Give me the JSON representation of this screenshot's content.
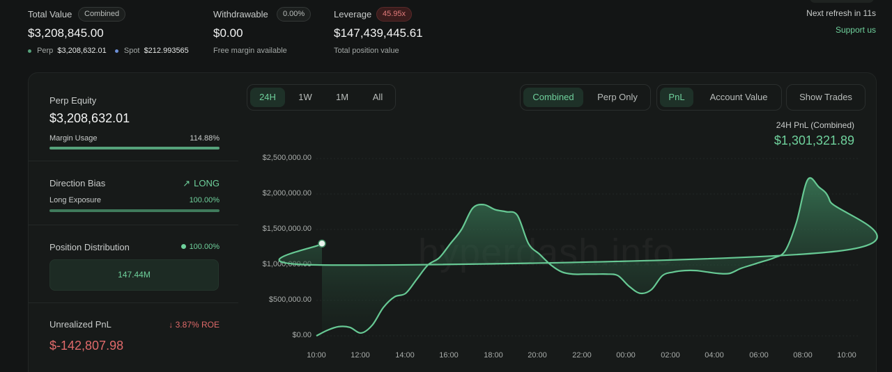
{
  "summary": {
    "total_value": {
      "label": "Total Value",
      "badge": "Combined",
      "value": "$3,208,845.00",
      "perp_label": "Perp",
      "perp_value": "$3,208,632.01",
      "spot_label": "Spot",
      "spot_value": "$212.993565"
    },
    "withdrawable": {
      "label": "Withdrawable",
      "badge": "0.00%",
      "value": "$0.00",
      "sub": "Free margin available"
    },
    "leverage": {
      "label": "Leverage",
      "badge": "45.95x",
      "value": "$147,439,445.61",
      "sub": "Total position value"
    },
    "refresh": "Next refresh in 11s",
    "support": "Support us"
  },
  "sidebar": {
    "perp_equity": {
      "label": "Perp Equity",
      "value": "$3,208,632.01",
      "margin_label": "Margin Usage",
      "margin_value": "114.88%"
    },
    "direction": {
      "label": "Direction Bias",
      "value": "LONG",
      "exposure_label": "Long Exposure",
      "exposure_value": "100.00%"
    },
    "distribution": {
      "label": "Position Distribution",
      "value": "100.00%",
      "box_value": "147.44M"
    },
    "unrealized": {
      "label": "Unrealized PnL",
      "roe": "↓ 3.87% ROE",
      "value": "$-142,807.98"
    }
  },
  "controls": {
    "ranges": [
      "24H",
      "1W",
      "1M",
      "All"
    ],
    "range_selected": "24H",
    "modes": [
      "Combined",
      "Perp Only"
    ],
    "mode_selected": "Combined",
    "metrics": [
      "PnL",
      "Account Value"
    ],
    "metric_selected": "PnL",
    "show_trades": "Show Trades"
  },
  "chart_info": {
    "title": "24H PnL (Combined)",
    "value": "$1,301,321.89",
    "watermark": "hyperdash.info"
  },
  "colors": {
    "accent": "#6fd19c",
    "negative": "#e06a6a",
    "background": "#131515"
  },
  "chart_data": {
    "type": "area",
    "x": [
      "10:00",
      "10:30",
      "11:00",
      "11:30",
      "12:00",
      "12:30",
      "13:00",
      "13:30",
      "14:00",
      "14:30",
      "15:00",
      "15:30",
      "16:00",
      "16:30",
      "17:00",
      "17:30",
      "18:00",
      "18:30",
      "19:00",
      "19:30",
      "20:00",
      "20:30",
      "21:00",
      "21:30",
      "22:00",
      "22:30",
      "23:00",
      "23:30",
      "00:00",
      "00:30",
      "01:00",
      "01:30",
      "02:00",
      "02:30",
      "03:00",
      "03:30",
      "04:00",
      "04:30",
      "05:00",
      "05:30",
      "06:00",
      "06:30",
      "07:00",
      "07:30",
      "08:00",
      "08:30",
      "09:00",
      "09:30",
      "10:00",
      "10:15"
    ],
    "values": [
      0,
      80000,
      130000,
      120000,
      40000,
      150000,
      400000,
      550000,
      600000,
      800000,
      1000000,
      1100000,
      1300000,
      1500000,
      1800000,
      1850000,
      1780000,
      1750000,
      1700000,
      1300000,
      1150000,
      1000000,
      900000,
      870000,
      870000,
      870000,
      870000,
      850000,
      700000,
      600000,
      650000,
      850000,
      900000,
      920000,
      920000,
      900000,
      880000,
      880000,
      950000,
      1000000,
      1050000,
      1100000,
      1200000,
      1600000,
      2200000,
      2100000,
      1900000,
      1200000,
      1000000,
      1301321.89
    ],
    "xticks": [
      "10:00",
      "12:00",
      "14:00",
      "16:00",
      "18:00",
      "20:00",
      "22:00",
      "00:00",
      "02:00",
      "04:00",
      "06:00",
      "08:00",
      "10:00"
    ],
    "yticks": [
      "$0.00",
      "$500,000.00",
      "$1,000,000.00",
      "$1,500,000.00",
      "$2,000,000.00",
      "$2,500,000.00"
    ],
    "ylim": [
      0,
      2500000
    ],
    "grid": true,
    "title": "",
    "xlabel": "",
    "ylabel": ""
  }
}
